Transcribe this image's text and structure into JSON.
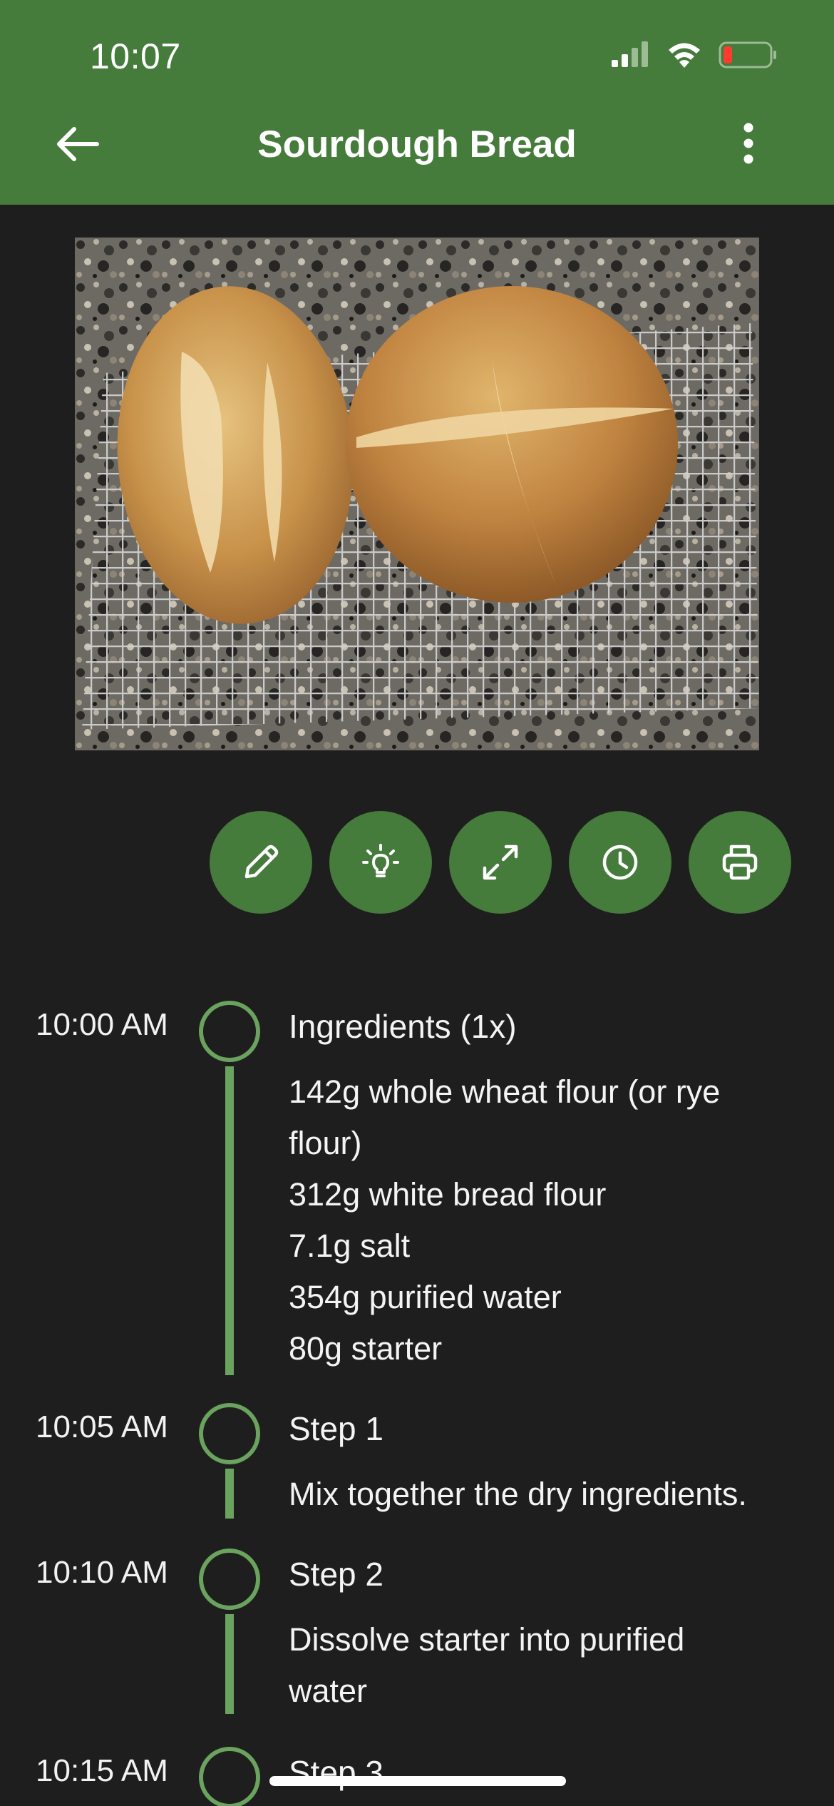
{
  "status_bar": {
    "time": "10:07"
  },
  "header": {
    "title": "Sourdough Bread",
    "back_icon": "arrow-left-icon",
    "menu_icon": "more-vert-icon"
  },
  "colors": {
    "brand": "#457b3b",
    "timeline": "#6aa35e",
    "background": "#1e1e1e"
  },
  "actions": [
    {
      "icon": "pencil-icon"
    },
    {
      "icon": "lightbulb-icon"
    },
    {
      "icon": "expand-icon"
    },
    {
      "icon": "clock-icon"
    },
    {
      "icon": "printer-icon"
    }
  ],
  "timeline": [
    {
      "time": "10:00 AM",
      "heading": "Ingredients (1x)",
      "lines": [
        "142g whole wheat flour (or rye",
        "flour)",
        "312g white bread flour",
        "7.1g salt",
        "354g purified water",
        "80g starter"
      ]
    },
    {
      "time": "10:05 AM",
      "heading": "Step 1",
      "lines": [
        "Mix together the dry ingredients."
      ]
    },
    {
      "time": "10:10 AM",
      "heading": "Step 2",
      "lines": [
        "Dissolve starter into purified",
        "water"
      ]
    },
    {
      "time": "10:15 AM",
      "heading": "Step 3",
      "lines": []
    }
  ]
}
